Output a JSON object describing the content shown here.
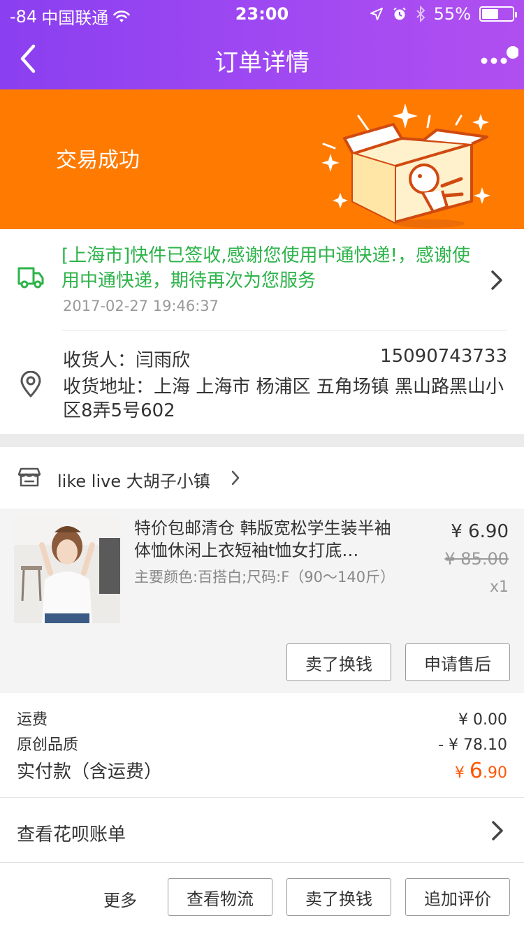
{
  "status_bar": {
    "signal": "-84",
    "carrier": "中国联通",
    "time": "23:00",
    "battery": "55%",
    "battery_level": 0.55
  },
  "nav": {
    "title": "订单详情",
    "back_icon": "chevron-left-icon",
    "more_icon": "more-dots-icon"
  },
  "banner": {
    "status": "交易成功",
    "color": "#ff7a00"
  },
  "logistics": {
    "message": "[上海市]快件已签收,感谢您使用中通快递!，感谢使用中通快递，期待再次为您服务",
    "time": "2017-02-27 19:46:37",
    "color": "#2db34a"
  },
  "address": {
    "receiver": "收货人：闫雨欣",
    "phone": "15090743733",
    "address": "收货地址：上海 上海市 杨浦区 五角场镇 黑山路黑山小区8弄5号602"
  },
  "shop": {
    "name": "like live 大胡子小镇"
  },
  "product": {
    "title": "特价包邮清仓 韩版宽松学生装半袖体恤休闲上衣短袖t恤女打底…",
    "sku": "主要颜色:百搭白;尺码:F（90～140斤）",
    "price": "¥ 6.90",
    "original_price": "¥ 85.00",
    "quantity": "x1",
    "buttons": {
      "sell": "卖了换钱",
      "after_sale": "申请售后"
    }
  },
  "fees": {
    "shipping_label": "运费",
    "shipping_value": "¥ 0.00",
    "discount_label": "原创品质",
    "discount_value": "- ¥ 78.10",
    "total_label": "实付款（含运费）",
    "total_currency": "¥ ",
    "total_int": "6",
    "total_dec": ".90",
    "accent": "#ff5500"
  },
  "huabei": {
    "label": "查看花呗账单"
  },
  "footer": {
    "more": "更多",
    "logistics": "查看物流",
    "sell": "卖了换钱",
    "review": "追加评价"
  }
}
